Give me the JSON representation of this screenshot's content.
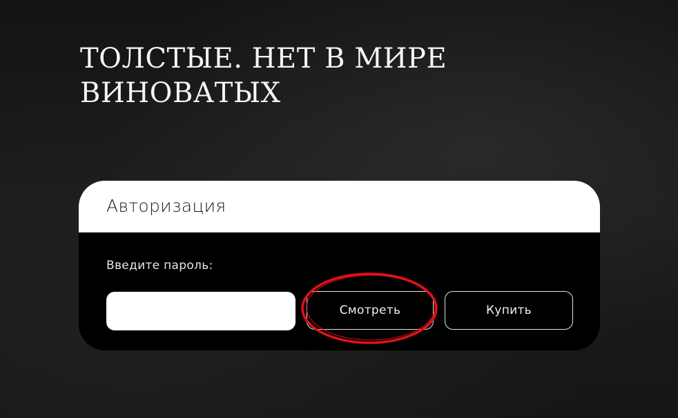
{
  "page": {
    "title": "ТОЛСТЫЕ. НЕТ В МИРЕ ВИНОВАТЫХ"
  },
  "auth": {
    "header": "Авторизация",
    "password_label": "Введите пароль:",
    "password_value": "",
    "watch_button": "Смотреть",
    "buy_button": "Купить"
  },
  "annotation": {
    "highlight_color": "#e0121b",
    "highlight_target": "watch_button"
  }
}
